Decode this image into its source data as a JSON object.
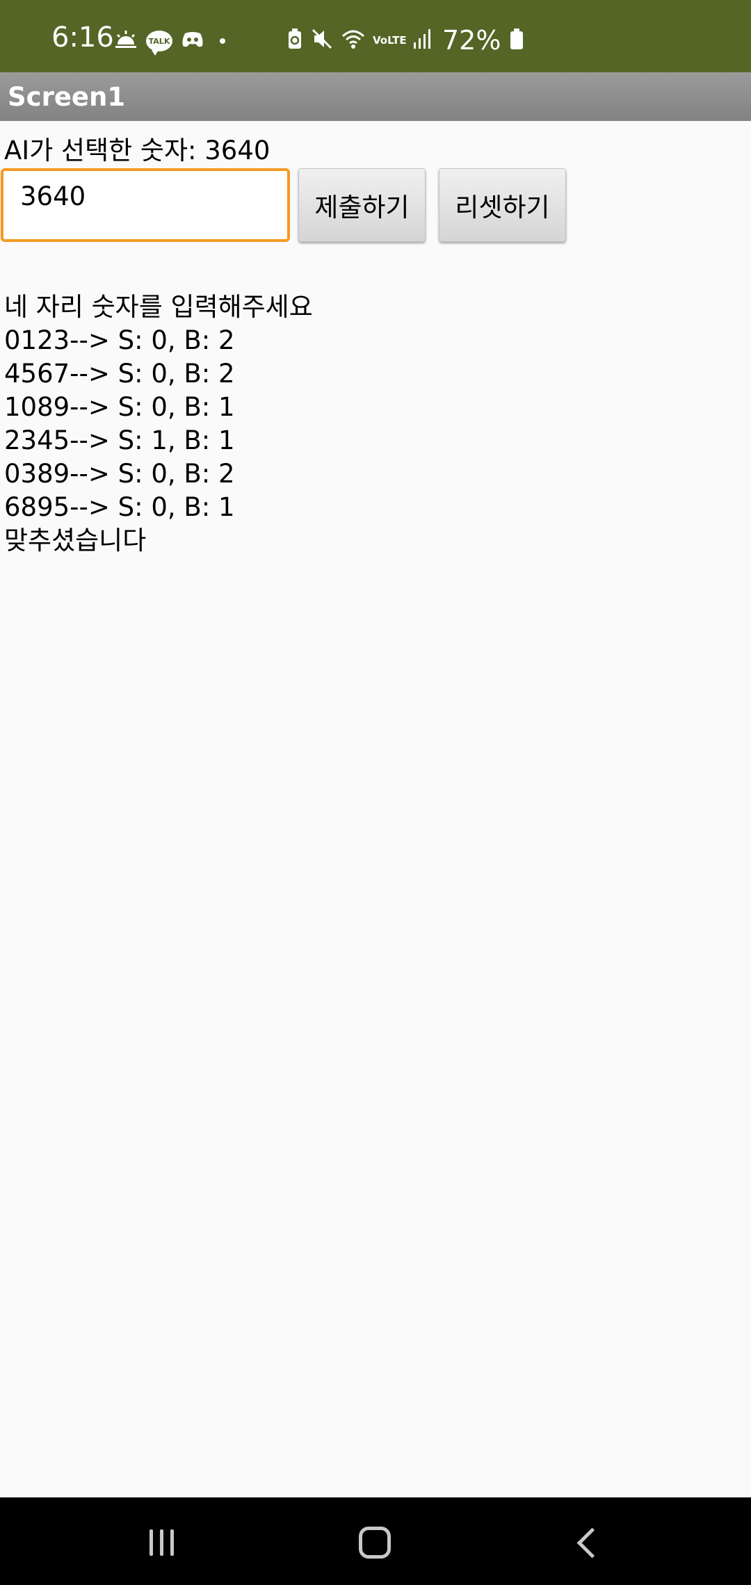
{
  "status_bar": {
    "time": "6:16",
    "talk_icon_text": "TALK",
    "battery_percent": "72%",
    "icons_left": [
      "sunrise-icon",
      "kakaotalk-icon",
      "discord-icon",
      "dot-icon"
    ],
    "icons_right": [
      "battery-saver-icon",
      "mute-icon",
      "wifi-icon",
      "volte-icon",
      "signal-icon",
      "battery-icon"
    ],
    "background_color": "#546526"
  },
  "title_bar": {
    "title": "Screen1"
  },
  "game": {
    "ai_number_label": "AI가 선택한 숫자: 3640",
    "input_value": "3640",
    "submit_label": "제출하기",
    "reset_label": "리셋하기",
    "log": [
      "네 자리 숫자를 입력해주세요",
      "0123--> S: 0, B: 2",
      "4567--> S: 0, B: 2",
      "1089--> S: 0, B: 1",
      "2345--> S: 1, B: 1",
      "0389--> S: 0, B: 2",
      "6895--> S: 0, B: 1",
      "맞추셨습니다"
    ],
    "input_border_color": "#f59a23"
  },
  "nav_bar": {
    "icons": [
      "recent-apps-icon",
      "home-icon",
      "back-icon"
    ]
  }
}
